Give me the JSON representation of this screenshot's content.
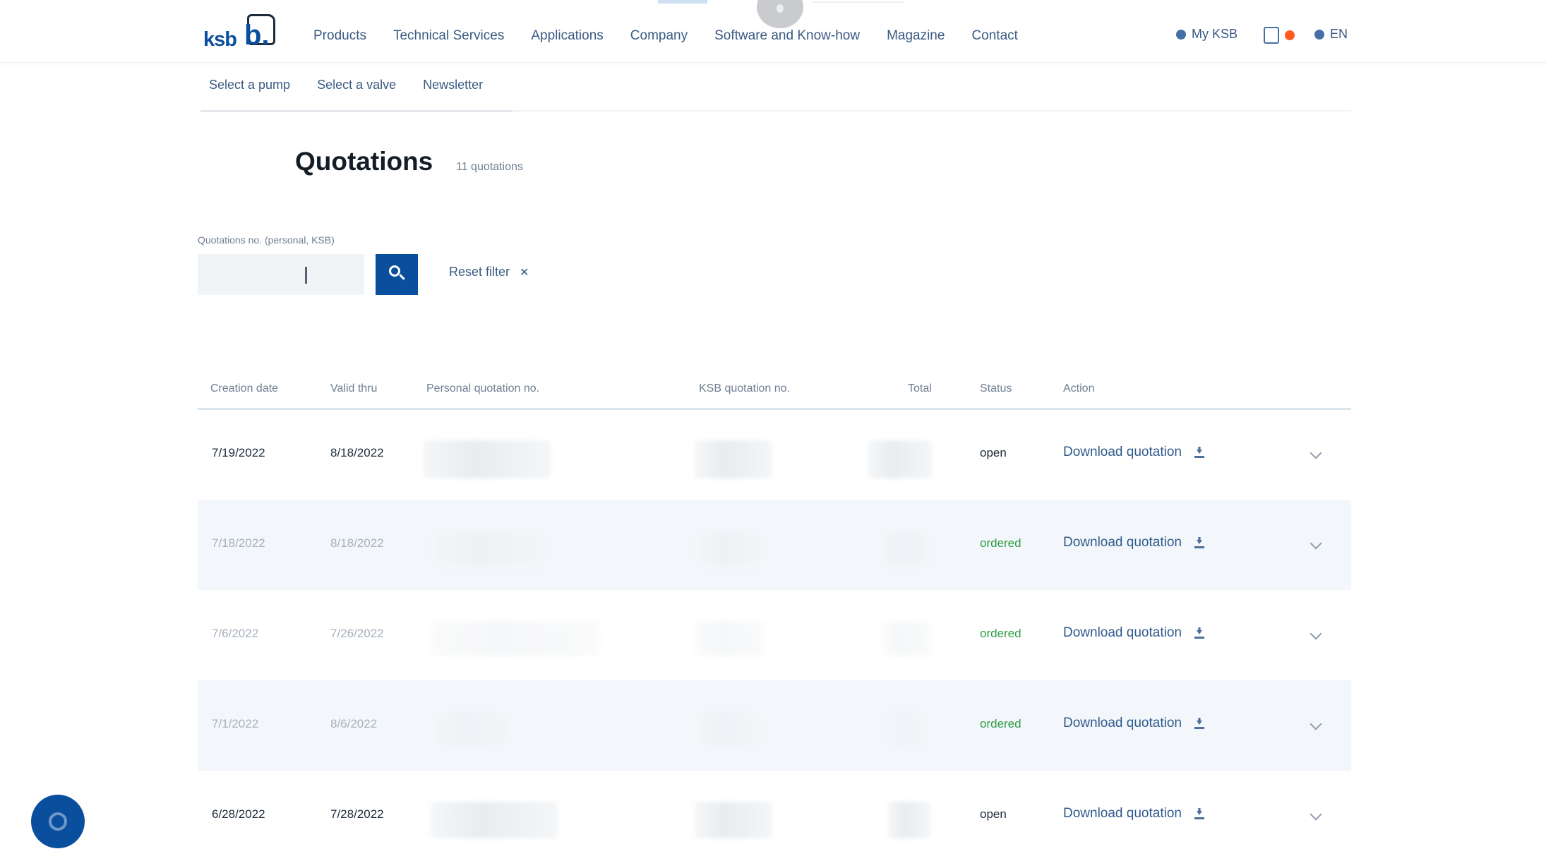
{
  "header": {
    "logo_text": "ksb",
    "logo_mark": "b.",
    "nav": [
      "Products",
      "Technical Services",
      "Applications",
      "Company",
      "Software and Know-how",
      "Magazine",
      "Contact"
    ],
    "my_ksb": "My KSB",
    "language": "EN"
  },
  "subnav": [
    "Select a pump",
    "Select a valve",
    "Newsletter"
  ],
  "page": {
    "title": "Quotations",
    "count": "11 quotations"
  },
  "filter": {
    "label": "Quotations no. (personal, KSB)",
    "search_value": "",
    "search_placeholder": "",
    "reset_label": "Reset filter"
  },
  "table": {
    "columns": [
      "Creation date",
      "Valid thru",
      "Personal quotation no.",
      "KSB quotation no.",
      "Total",
      "Status",
      "Action"
    ],
    "rows": [
      {
        "created": "7/19/2022",
        "valid": "8/18/2022",
        "status": "open",
        "action": "Download quotation"
      },
      {
        "created": "7/18/2022",
        "valid": "8/18/2022",
        "status": "ordered",
        "action": "Download quotation"
      },
      {
        "created": "7/6/2022",
        "valid": "7/26/2022",
        "status": "ordered",
        "action": "Download quotation"
      },
      {
        "created": "7/1/2022",
        "valid": "8/6/2022",
        "status": "ordered",
        "action": "Download quotation"
      },
      {
        "created": "6/28/2022",
        "valid": "7/28/2022",
        "status": "open",
        "action": "Download quotation"
      }
    ]
  },
  "colors": {
    "brand": "#0a4f9e",
    "ordered": "#2e9b43",
    "badge": "#ff5a1f"
  },
  "icons": [
    "search-icon",
    "close-icon",
    "download-icon",
    "chevron-down-icon",
    "globe-icon",
    "cart-icon",
    "chat-icon"
  ]
}
